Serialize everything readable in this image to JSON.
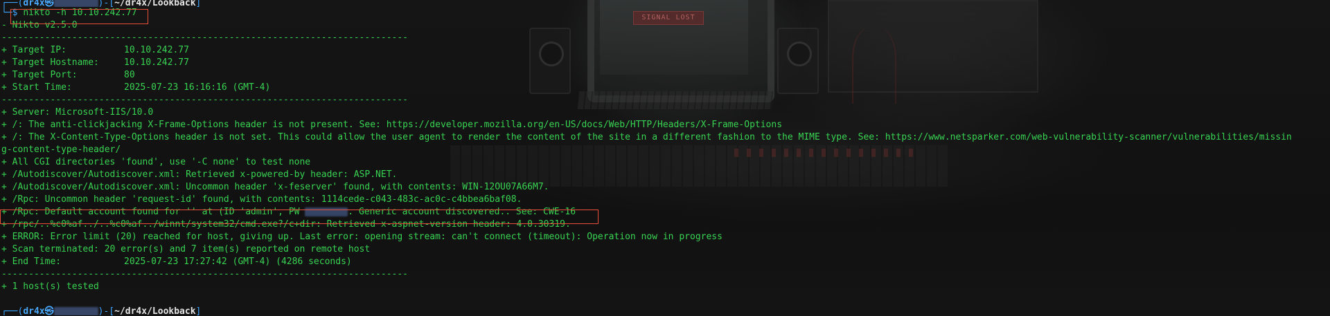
{
  "prompt_top": {
    "user": "dr4x",
    "host_redacted": "kali",
    "path": "~/dr4x/Lookback"
  },
  "command": {
    "symbol": "$",
    "text": "nikto -h 10.10.242.77"
  },
  "lines": {
    "version": "- Nikto v2.5.0",
    "sep1": "---------------------------------------------------------------------------",
    "target_ip_label": "+ Target IP:",
    "target_ip_value": "10.10.242.77",
    "target_hostname_label": "+ Target Hostname:",
    "target_hostname_value": "10.10.242.77",
    "target_port_label": "+ Target Port:",
    "target_port_value": "80",
    "start_time_label": "+ Start Time:",
    "start_time_value": "2025-07-23 16:16:16 (GMT-4)",
    "sep2": "---------------------------------------------------------------------------",
    "server": "+ Server: Microsoft-IIS/10.0",
    "xframe": "+ /: The anti-clickjacking X-Frame-Options header is not present. See: https://developer.mozilla.org/en-US/docs/Web/HTTP/Headers/X-Frame-Options",
    "xcontent_a": "+ /: The X-Content-Type-Options header is not set. This could allow the user agent to render the content of the site in a different fashion to the MIME type. See: https://www.netsparker.com/web-vulnerability-scanner/vulnerabilities/missin",
    "xcontent_b": "g-content-type-header/",
    "cgi": "+ All CGI directories 'found', use '-C none' to test none",
    "autodiscover1": "+ /Autodiscover/Autodiscover.xml: Retrieved x-powered-by header: ASP.NET.",
    "autodiscover2": "+ /Autodiscover/Autodiscover.xml: Uncommon header 'x-feserver' found, with contents: WIN-12OU07A66M7.",
    "rpc1": "+ /Rpc: Uncommon header 'request-id' found, with contents: 1114cede-c043-483c-ac0c-c4bbea6baf08.",
    "rpc2_before": "+ /Rpc: Default account found for '' at (ID 'admin', PW",
    "rpc2_redacted": "********",
    "rpc2_after": ". Generic account discovered.. See: CWE-16",
    "aspnet": "+ /rpc/..%c0%af../..%c0%af../winnt/system32/cmd.exe?/c+dir: Retrieved x-aspnet-version header: 4.0.30319.",
    "error": "+ ERROR: Error limit (20) reached for host, giving up. Last error: opening stream: can't connect (timeout): Operation now in progress",
    "scan_terminated": "+ Scan terminated: 20 error(s) and 7 item(s) reported on remote host",
    "end_time_label": "+ End Time:",
    "end_time_value": "2025-07-23 17:27:42 (GMT-4) (4286 seconds)",
    "sep3": "---------------------------------------------------------------------------",
    "hosts_tested": "+ 1 host(s) tested"
  },
  "prompt_bottom": {
    "user": "dr4x",
    "host_redacted": "kali",
    "path": "~/dr4x/Lookback"
  },
  "wallpaper": {
    "monitor_text": "SIGNAL LOST"
  },
  "colors": {
    "output_green": "#39d353",
    "prompt_blue": "#3ea5ff",
    "annotation_red": "#e8503a",
    "background": "#121212"
  }
}
